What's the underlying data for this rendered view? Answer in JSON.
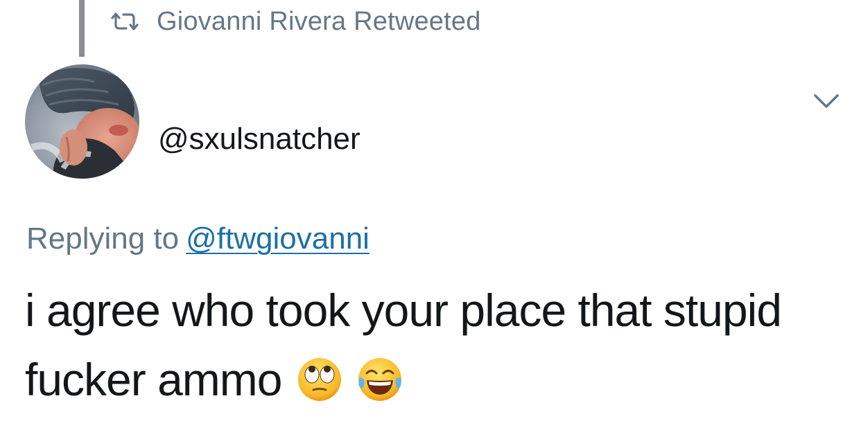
{
  "retweet": {
    "label": "Giovanni Rivera Retweeted",
    "icon": "retweet-icon"
  },
  "author": {
    "handle": "@sxulsnatcher",
    "avatar": "profile-photo"
  },
  "menu": {
    "icon": "chevron-down-icon"
  },
  "reply": {
    "prefix": "Replying to",
    "target": "@ftwgiovanni"
  },
  "tweet": {
    "text": "i agree who took your place that stupid fucker ammo",
    "emojis": [
      "face-with-rolling-eyes",
      "face-with-tears-of-joy"
    ]
  },
  "colors": {
    "secondary_text": "#657786",
    "link": "#1b6fa8",
    "primary_text": "#14171a",
    "thread_line": "#8a8d91"
  }
}
